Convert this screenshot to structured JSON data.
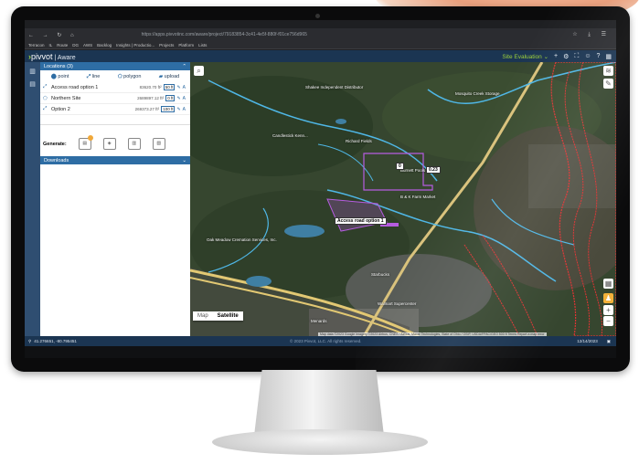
{
  "browser": {
    "url": "https://apps.pivvotinc.com/aware/project/79183854-3c41-4e5f-880f-f01ce756d965",
    "bookmarks": [
      "Terracon",
      "IL",
      "Route",
      "DG",
      "AWS",
      "Backlog",
      "Insights | Productio...",
      "Projects",
      "Platform",
      "Lists"
    ]
  },
  "app": {
    "logo": "pivvot",
    "product": "Aware",
    "view": "Site Evaluation"
  },
  "panel": {
    "locations_title": "Locations (3)",
    "tools": [
      {
        "icon": "point-icon",
        "label": "point"
      },
      {
        "icon": "line-icon",
        "label": "line"
      },
      {
        "icon": "polygon-icon",
        "label": "polygon"
      },
      {
        "icon": "upload-icon",
        "label": "upload"
      }
    ],
    "locations": [
      {
        "icon": "line-icon",
        "name": "Access road option 1",
        "area": "83620.70 ft²",
        "buffer": "50 ft"
      },
      {
        "icon": "polygon-icon",
        "name": "Northern Site",
        "area": "2689897.12 ft²",
        "buffer": "0 ft"
      },
      {
        "icon": "line-icon",
        "name": "Option 2",
        "area": "269373.27 ft²",
        "buffer": "100 ft"
      }
    ],
    "generate_label": "Generate:",
    "downloads_title": "Downloads"
  },
  "map": {
    "callouts": [
      "Access road option 1",
      "0",
      "0.23"
    ],
    "labels": [
      "Shakee Independent Distributor",
      "Mosquito Creek Storage",
      "Candlestick Kenn...",
      "Richard Fields",
      "Burnett Pools",
      "B & K Farm Market",
      "Oak Meadow Cremation Services, Inc.",
      "Walmart Supercenter",
      "Starbucks",
      "Menards"
    ],
    "map_type": [
      "Map",
      "Satellite"
    ],
    "attribution": "Map data ©2023 Google Imagery ©2023 Airbus, CNES / Airbus, Maxar Technologies, State of Ohio / OSIP, USDA/FPAC/GEO   500 ft   Terms   Report a map error"
  },
  "status": {
    "coords": "41.276651, -80.795451",
    "copyright": "© 2023 Pivvot, LLC. All rights reserved.",
    "date": "12/14/2023"
  },
  "colors": {
    "header": "#1b3552",
    "accent_green": "#9ed13b",
    "panel_blue": "#2e6da4"
  }
}
